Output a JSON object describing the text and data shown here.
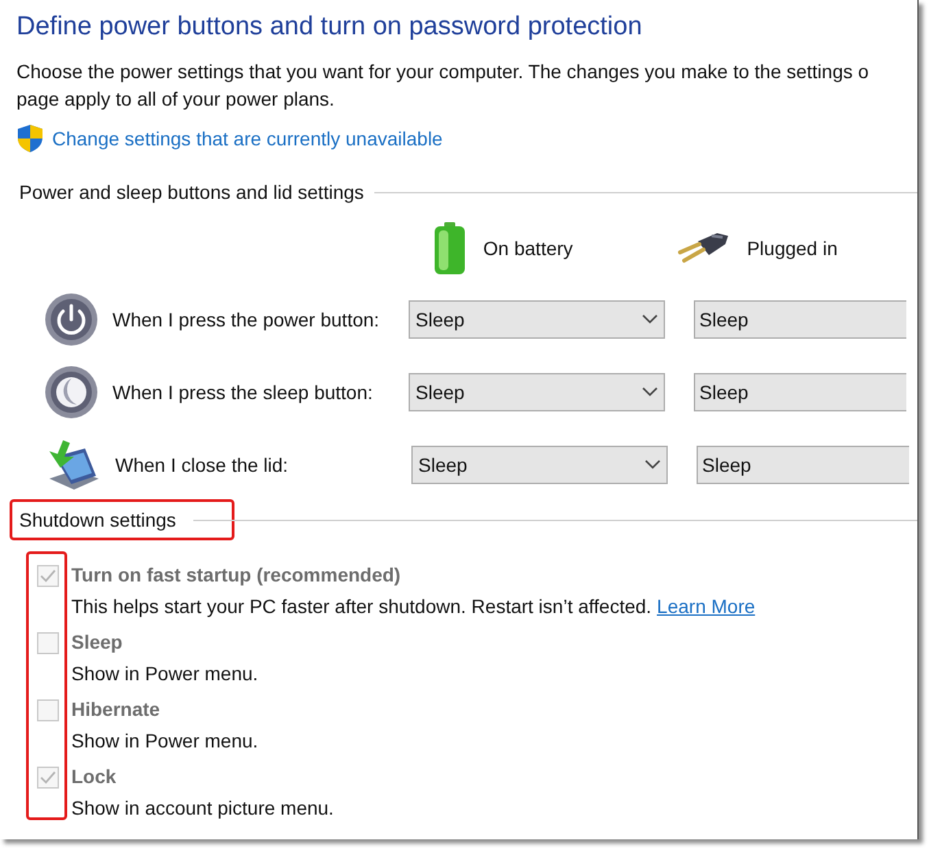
{
  "title": "Define power buttons and turn on password protection",
  "description_lines": [
    "Choose the power settings that you want for your computer. The changes you make to the settings o",
    "page apply to all of your power plans."
  ],
  "admin_link": "Change settings that are currently unavailable",
  "buttons_section": {
    "heading": "Power and sleep buttons and lid settings",
    "columns": [
      {
        "kind": "battery",
        "label": "On battery"
      },
      {
        "kind": "plug",
        "label": "Plugged in"
      }
    ],
    "rows": [
      {
        "kind": "power",
        "label": "When I press the power button:",
        "values": [
          "Sleep",
          "Sleep"
        ]
      },
      {
        "kind": "sleep",
        "label": "When I press the sleep button:",
        "values": [
          "Sleep",
          "Sleep"
        ]
      },
      {
        "kind": "lid",
        "label": "When I close the lid:",
        "values": [
          "Sleep",
          "Sleep"
        ]
      }
    ]
  },
  "shutdown_section": {
    "heading": "Shutdown settings",
    "options": [
      {
        "label": "Turn on fast startup (recommended)",
        "checked": true,
        "disabled": true,
        "description": "This helps start your PC faster after shutdown. Restart isn’t affected.",
        "link": "Learn More"
      },
      {
        "label": "Sleep",
        "checked": false,
        "disabled": true,
        "description": "Show in Power menu."
      },
      {
        "label": "Hibernate",
        "checked": false,
        "disabled": true,
        "description": "Show in Power menu."
      },
      {
        "label": "Lock",
        "checked": true,
        "disabled": true,
        "description": "Show in account picture menu."
      }
    ]
  }
}
